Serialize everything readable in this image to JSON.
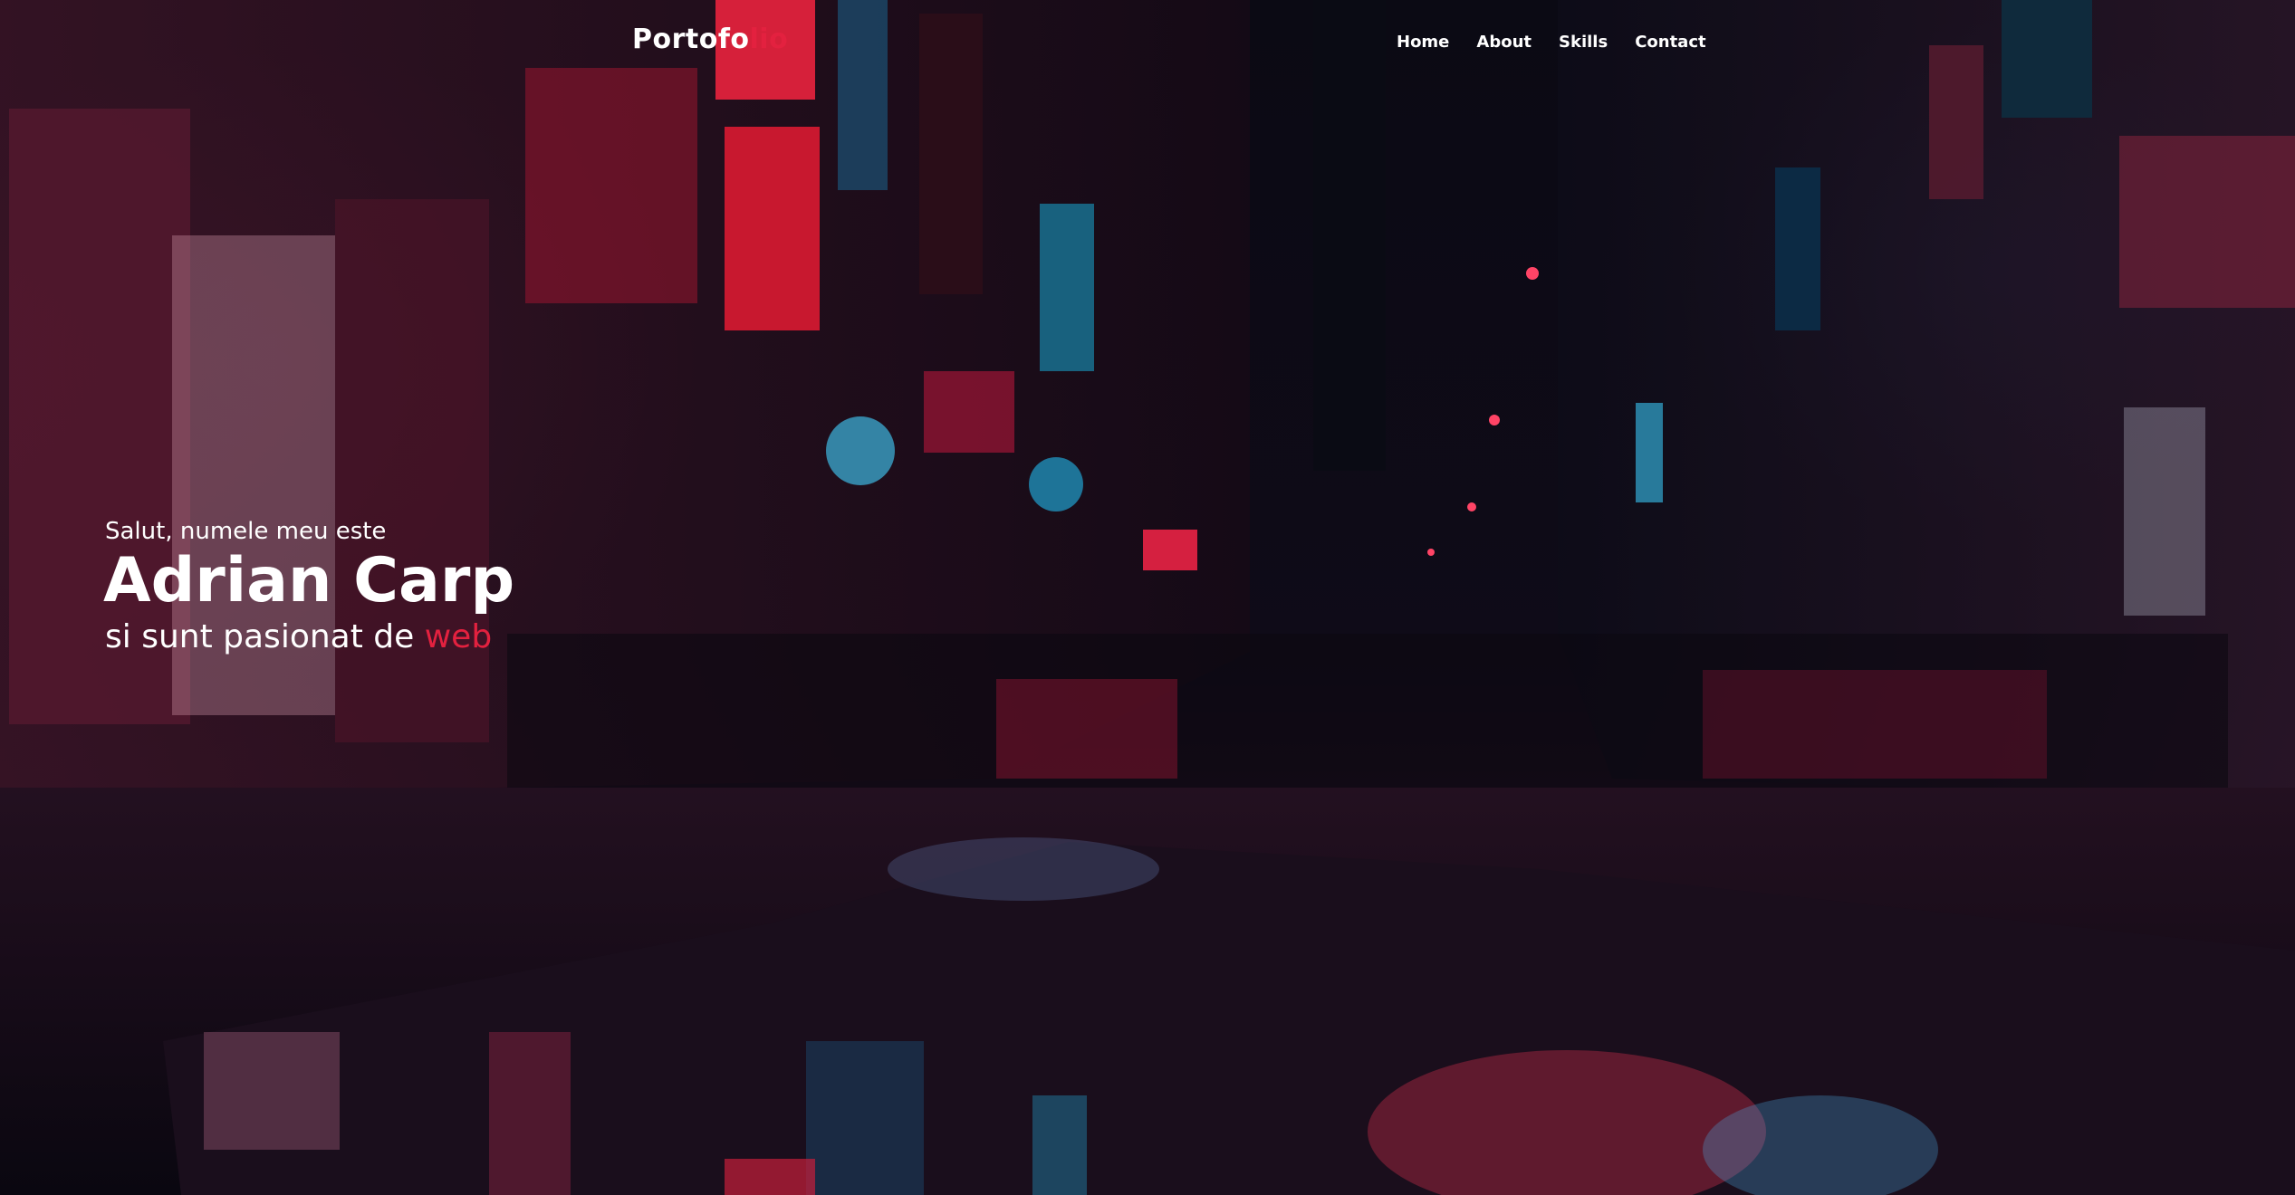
{
  "navbar": {
    "brand_main": "Portofo",
    "brand_accent": "lio",
    "links": [
      {
        "label": "Home"
      },
      {
        "label": "About"
      },
      {
        "label": "Skills"
      },
      {
        "label": "Contact"
      }
    ]
  },
  "hero": {
    "greeting": "Salut, numele meu este",
    "name": "Adrian Carp",
    "tagline_prefix": "si sunt pasionat de ",
    "tagline_accent": "web"
  },
  "colors": {
    "accent": "#e3213f",
    "text": "#ffffff",
    "background": "#0b0a14"
  }
}
